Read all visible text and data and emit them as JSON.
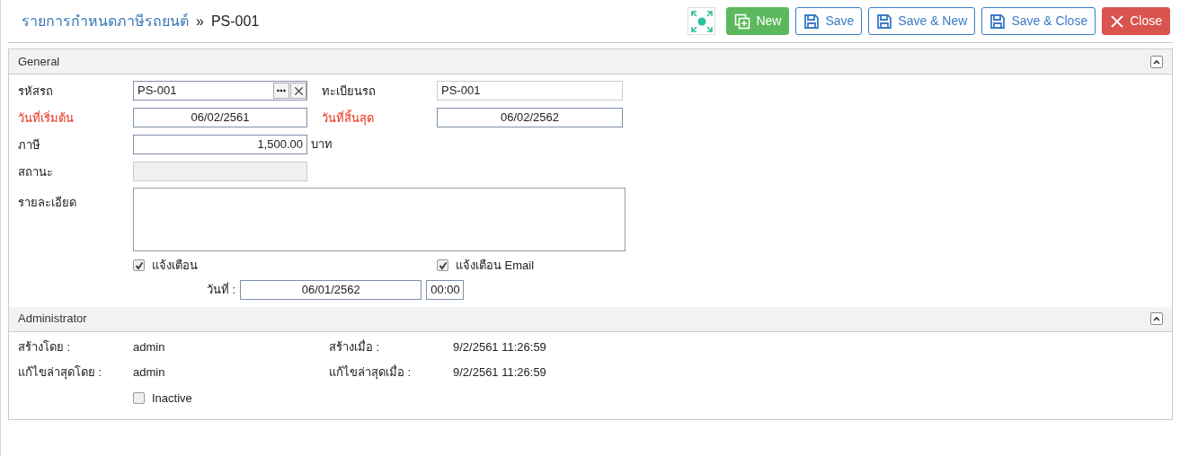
{
  "breadcrumb": {
    "parent": "รายการกำหนดภาษีรถยนต์",
    "separator": "»",
    "current": "PS-001"
  },
  "toolbar": [
    {
      "kind": "new",
      "label": "New"
    },
    {
      "kind": "save",
      "label": "Save"
    },
    {
      "kind": "save",
      "label": "Save & New"
    },
    {
      "kind": "save",
      "label": "Save & Close"
    },
    {
      "kind": "close",
      "label": "Close"
    }
  ],
  "general": {
    "title": "General",
    "expanded": true,
    "car_code": {
      "label": "รหัสรถ",
      "value": "PS-001"
    },
    "plate": {
      "label": "ทะเบียนรถ",
      "value": "PS-001"
    },
    "start_date": {
      "label": "วันที่เริ่มต้น",
      "value": "06/02/2561",
      "required": true
    },
    "end_date": {
      "label": "วันที่สิ้นสุด",
      "value": "06/02/2562",
      "required": true
    },
    "tax": {
      "label": "ภาษี",
      "value": "1,500.00",
      "unit": "บาท"
    },
    "status": {
      "label": "สถานะ"
    },
    "detail": {
      "label": "รายละเอียด"
    },
    "notify": {
      "label": "แจ้งเตือน",
      "checked": true
    },
    "notify_email": {
      "label": "แจ้งเตือน Email",
      "checked": true
    },
    "notify_date": {
      "label": "วันที่ :",
      "date": "06/01/2562",
      "time": "00:00"
    }
  },
  "administrator": {
    "title": "Administrator",
    "expanded": true,
    "created_by": {
      "label": "สร้างโดย :",
      "value": "admin"
    },
    "created_at": {
      "label": "สร้างเมื่อ :",
      "value": "9/2/2561 11:26:59"
    },
    "modified_by": {
      "label": "แก้ไขล่าสุดโดย :",
      "value": "admin"
    },
    "modified_at": {
      "label": "แก้ไขล่าสุดเมื่อ :",
      "value": "9/2/2561 11:26:59"
    },
    "inactive": {
      "label": "Inactive",
      "checked": false
    }
  }
}
